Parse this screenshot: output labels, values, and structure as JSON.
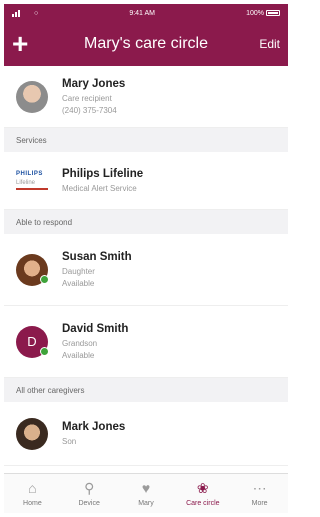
{
  "status": {
    "time": "9:41 AM",
    "battery": "100%"
  },
  "nav": {
    "add_icon": "+",
    "title": "Mary's care circle",
    "edit_label": "Edit"
  },
  "recipient": {
    "name": "Mary Jones",
    "role": "Care recipient",
    "phone": "(240) 375-7304"
  },
  "sections": {
    "services": "Services",
    "able": "Able to respond",
    "others": "All other caregivers"
  },
  "service": {
    "logo_text": "PHILIPS",
    "logo_sub": "Lifeline",
    "name": "Philips Lifeline",
    "desc": "Medical Alert Service"
  },
  "able": [
    {
      "name": "Susan Smith",
      "relation": "Daughter",
      "status": "Available",
      "status_color": "#3ea33a"
    },
    {
      "name": "David Smith",
      "initial": "D",
      "relation": "Grandson",
      "status": "Available",
      "status_color": "#3ea33a"
    }
  ],
  "others": [
    {
      "name": "Mark Jones",
      "relation": "Son"
    }
  ],
  "tabs": [
    {
      "label": "Home",
      "icon": "home-icon"
    },
    {
      "label": "Device",
      "icon": "device-icon"
    },
    {
      "label": "Mary",
      "icon": "heart-icon"
    },
    {
      "label": "Care circle",
      "icon": "paw-icon",
      "active": true
    },
    {
      "label": "More",
      "icon": "more-icon"
    }
  ],
  "colors": {
    "brand": "#8b1a4c",
    "available": "#3ea33a"
  }
}
